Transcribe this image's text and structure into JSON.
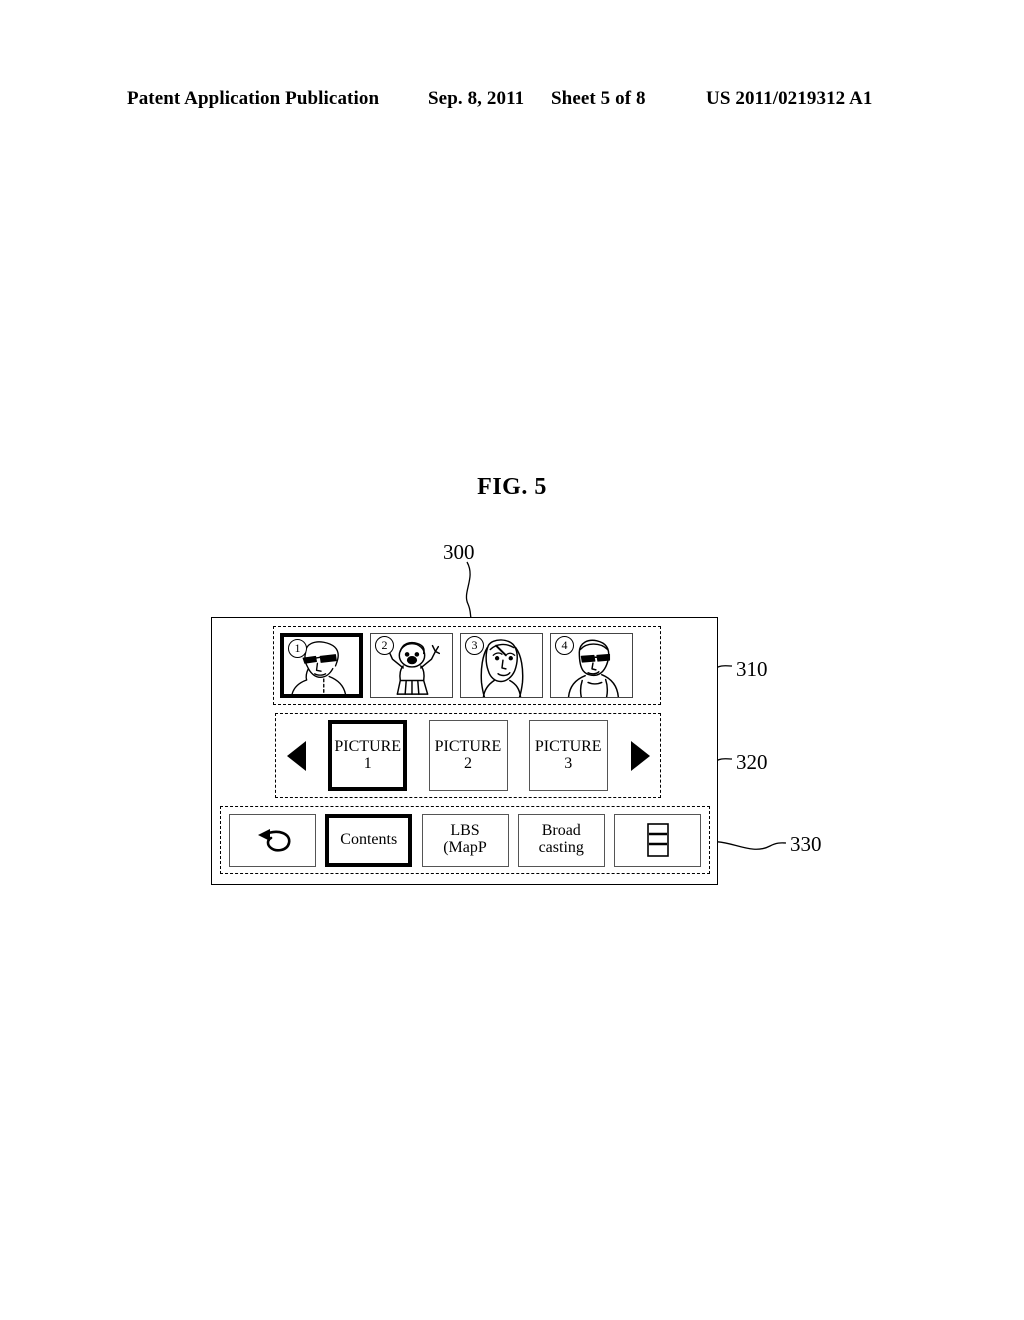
{
  "page_header": {
    "publication": "Patent Application Publication",
    "date": "Sep. 8, 2011",
    "sheet": "Sheet 5 of 8",
    "patent_number": "US 2011/0219312 A1"
  },
  "figure": {
    "title": "FIG. 5"
  },
  "reference_numerals": {
    "device": "300",
    "thumbnail_group": "310",
    "picture_group": "320",
    "toolbar_group": "330"
  },
  "device": {
    "thumbnail_bar": {
      "items": [
        {
          "badge": "1",
          "icon": "man-with-glasses-portrait-icon",
          "selected": true
        },
        {
          "badge": "2",
          "icon": "child-arms-raised-icon",
          "selected": false
        },
        {
          "badge": "3",
          "icon": "woman-long-hair-portrait-icon",
          "selected": false
        },
        {
          "badge": "4",
          "icon": "person-with-backpack-icon",
          "selected": false
        }
      ]
    },
    "picture_carousel": {
      "prev_icon": "left-triangle-arrow-icon",
      "next_icon": "right-triangle-arrow-icon",
      "tiles": [
        {
          "line1": "PICTURE",
          "line2": "1",
          "selected": true
        },
        {
          "line1": "PICTURE",
          "line2": "2",
          "selected": false
        },
        {
          "line1": "PICTURE",
          "line2": "3",
          "selected": false
        }
      ]
    },
    "toolbar": {
      "buttons": [
        {
          "type": "icon",
          "icon": "back-return-arrow-icon",
          "line1": "",
          "line2": "",
          "selected": false
        },
        {
          "type": "text",
          "icon": "",
          "line1": "Contents",
          "line2": "",
          "selected": true
        },
        {
          "type": "text",
          "icon": "",
          "line1": "LBS",
          "line2": "(MapP",
          "selected": false
        },
        {
          "type": "text",
          "icon": "",
          "line1": "Broad",
          "line2": "casting",
          "selected": false
        },
        {
          "type": "icon",
          "icon": "list-menu-icon",
          "line1": "",
          "line2": "",
          "selected": false
        }
      ]
    }
  },
  "colors": {
    "ink": "#000000",
    "paper": "#ffffff",
    "tile_border": "#555555"
  }
}
